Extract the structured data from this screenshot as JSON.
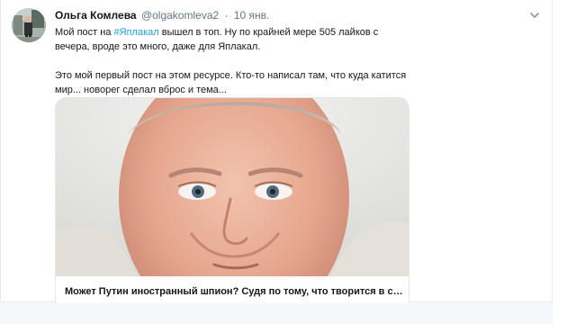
{
  "tweet": {
    "author_name": "Ольга Комлева",
    "author_handle": "@olgakomleva2",
    "separator": "·",
    "timestamp": "10 янв.",
    "text_line1_before": "Мой пост на ",
    "hashtag": "#Яплакал",
    "text_line1_after": " вышел в топ. Ну по крайней мере 505  лайков  с вечера, вроде это много, даже для Яплакал.",
    "text_paragraph2": "Это мой первый пост на этом ресурсе. Кто-то написал там, что куда катится мир... новорег сделал вброс и тема..."
  },
  "card": {
    "title": "Может Путин иностранный шпион? Судя по тому, что творится в стране..."
  },
  "icons": {
    "avatar": "avatar-photo",
    "menu": "chevron-down-icon"
  }
}
